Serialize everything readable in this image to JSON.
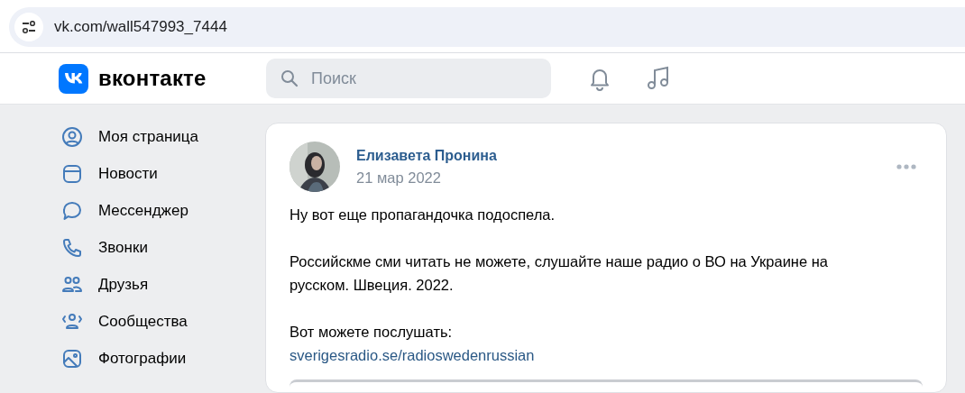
{
  "address_bar": {
    "url": "vk.com/wall547993_7444"
  },
  "header": {
    "logo_text": "вконтакте",
    "search": {
      "placeholder": "Поиск"
    }
  },
  "sidebar": {
    "items": [
      {
        "label": "Моя страница",
        "kind": "profile"
      },
      {
        "label": "Новости",
        "kind": "news"
      },
      {
        "label": "Мессенджер",
        "kind": "messenger"
      },
      {
        "label": "Звонки",
        "kind": "calls"
      },
      {
        "label": "Друзья",
        "kind": "friends"
      },
      {
        "label": "Сообщества",
        "kind": "groups"
      },
      {
        "label": "Фотографии",
        "kind": "photos"
      }
    ]
  },
  "post": {
    "author": "Елизавета Пронина",
    "date": "21 мар 2022",
    "paragraphs": [
      [
        "Ну вот еще пропагандочка подоспела."
      ],
      [
        "Российскме сми читать не можете, слушайте наше радио о ВО на Украине на русском. Швеция. 2022."
      ],
      [
        "Вот можете послушать:"
      ]
    ],
    "link": "sverigesradio.se/radioswedenrussian"
  }
}
